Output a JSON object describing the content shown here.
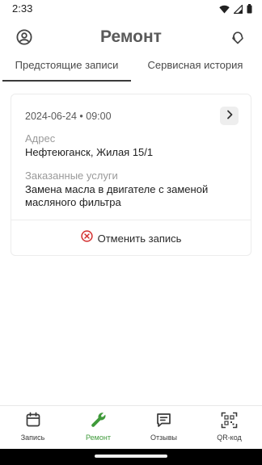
{
  "status_bar": {
    "time": "2:33",
    "icons": [
      "wifi-icon",
      "signal-icon",
      "battery-icon"
    ]
  },
  "header": {
    "title": "Ремонт",
    "left_icon": "account-icon",
    "right_icon": "support-icon"
  },
  "tabs": [
    {
      "label": "Предстоящие записи",
      "active": true
    },
    {
      "label": "Сервисная история",
      "active": false
    }
  ],
  "appointment": {
    "datetime": "2024-06-24 • 09:00",
    "address_label": "Адрес",
    "address_value": "Нефтеюганск, Жилая 15/1",
    "services_label": "Заказанные услуги",
    "services_value": "Замена масла в двигателе с заменой масляного фильтра",
    "cancel_label": "Отменить запись",
    "cancel_icon": "cancel-circle-icon",
    "details_icon": "chevron-right-icon"
  },
  "bottom_nav": [
    {
      "label": "Запись",
      "icon": "calendar-icon",
      "active": false
    },
    {
      "label": "Ремонт",
      "icon": "wrench-icon",
      "active": true
    },
    {
      "label": "Отзывы",
      "icon": "chat-icon",
      "active": false
    },
    {
      "label": "QR-код",
      "icon": "qr-scan-icon",
      "active": false
    }
  ],
  "colors": {
    "accent": "#3f9a3a",
    "cancel": "#d32f2f",
    "title": "#5a5a5a"
  }
}
